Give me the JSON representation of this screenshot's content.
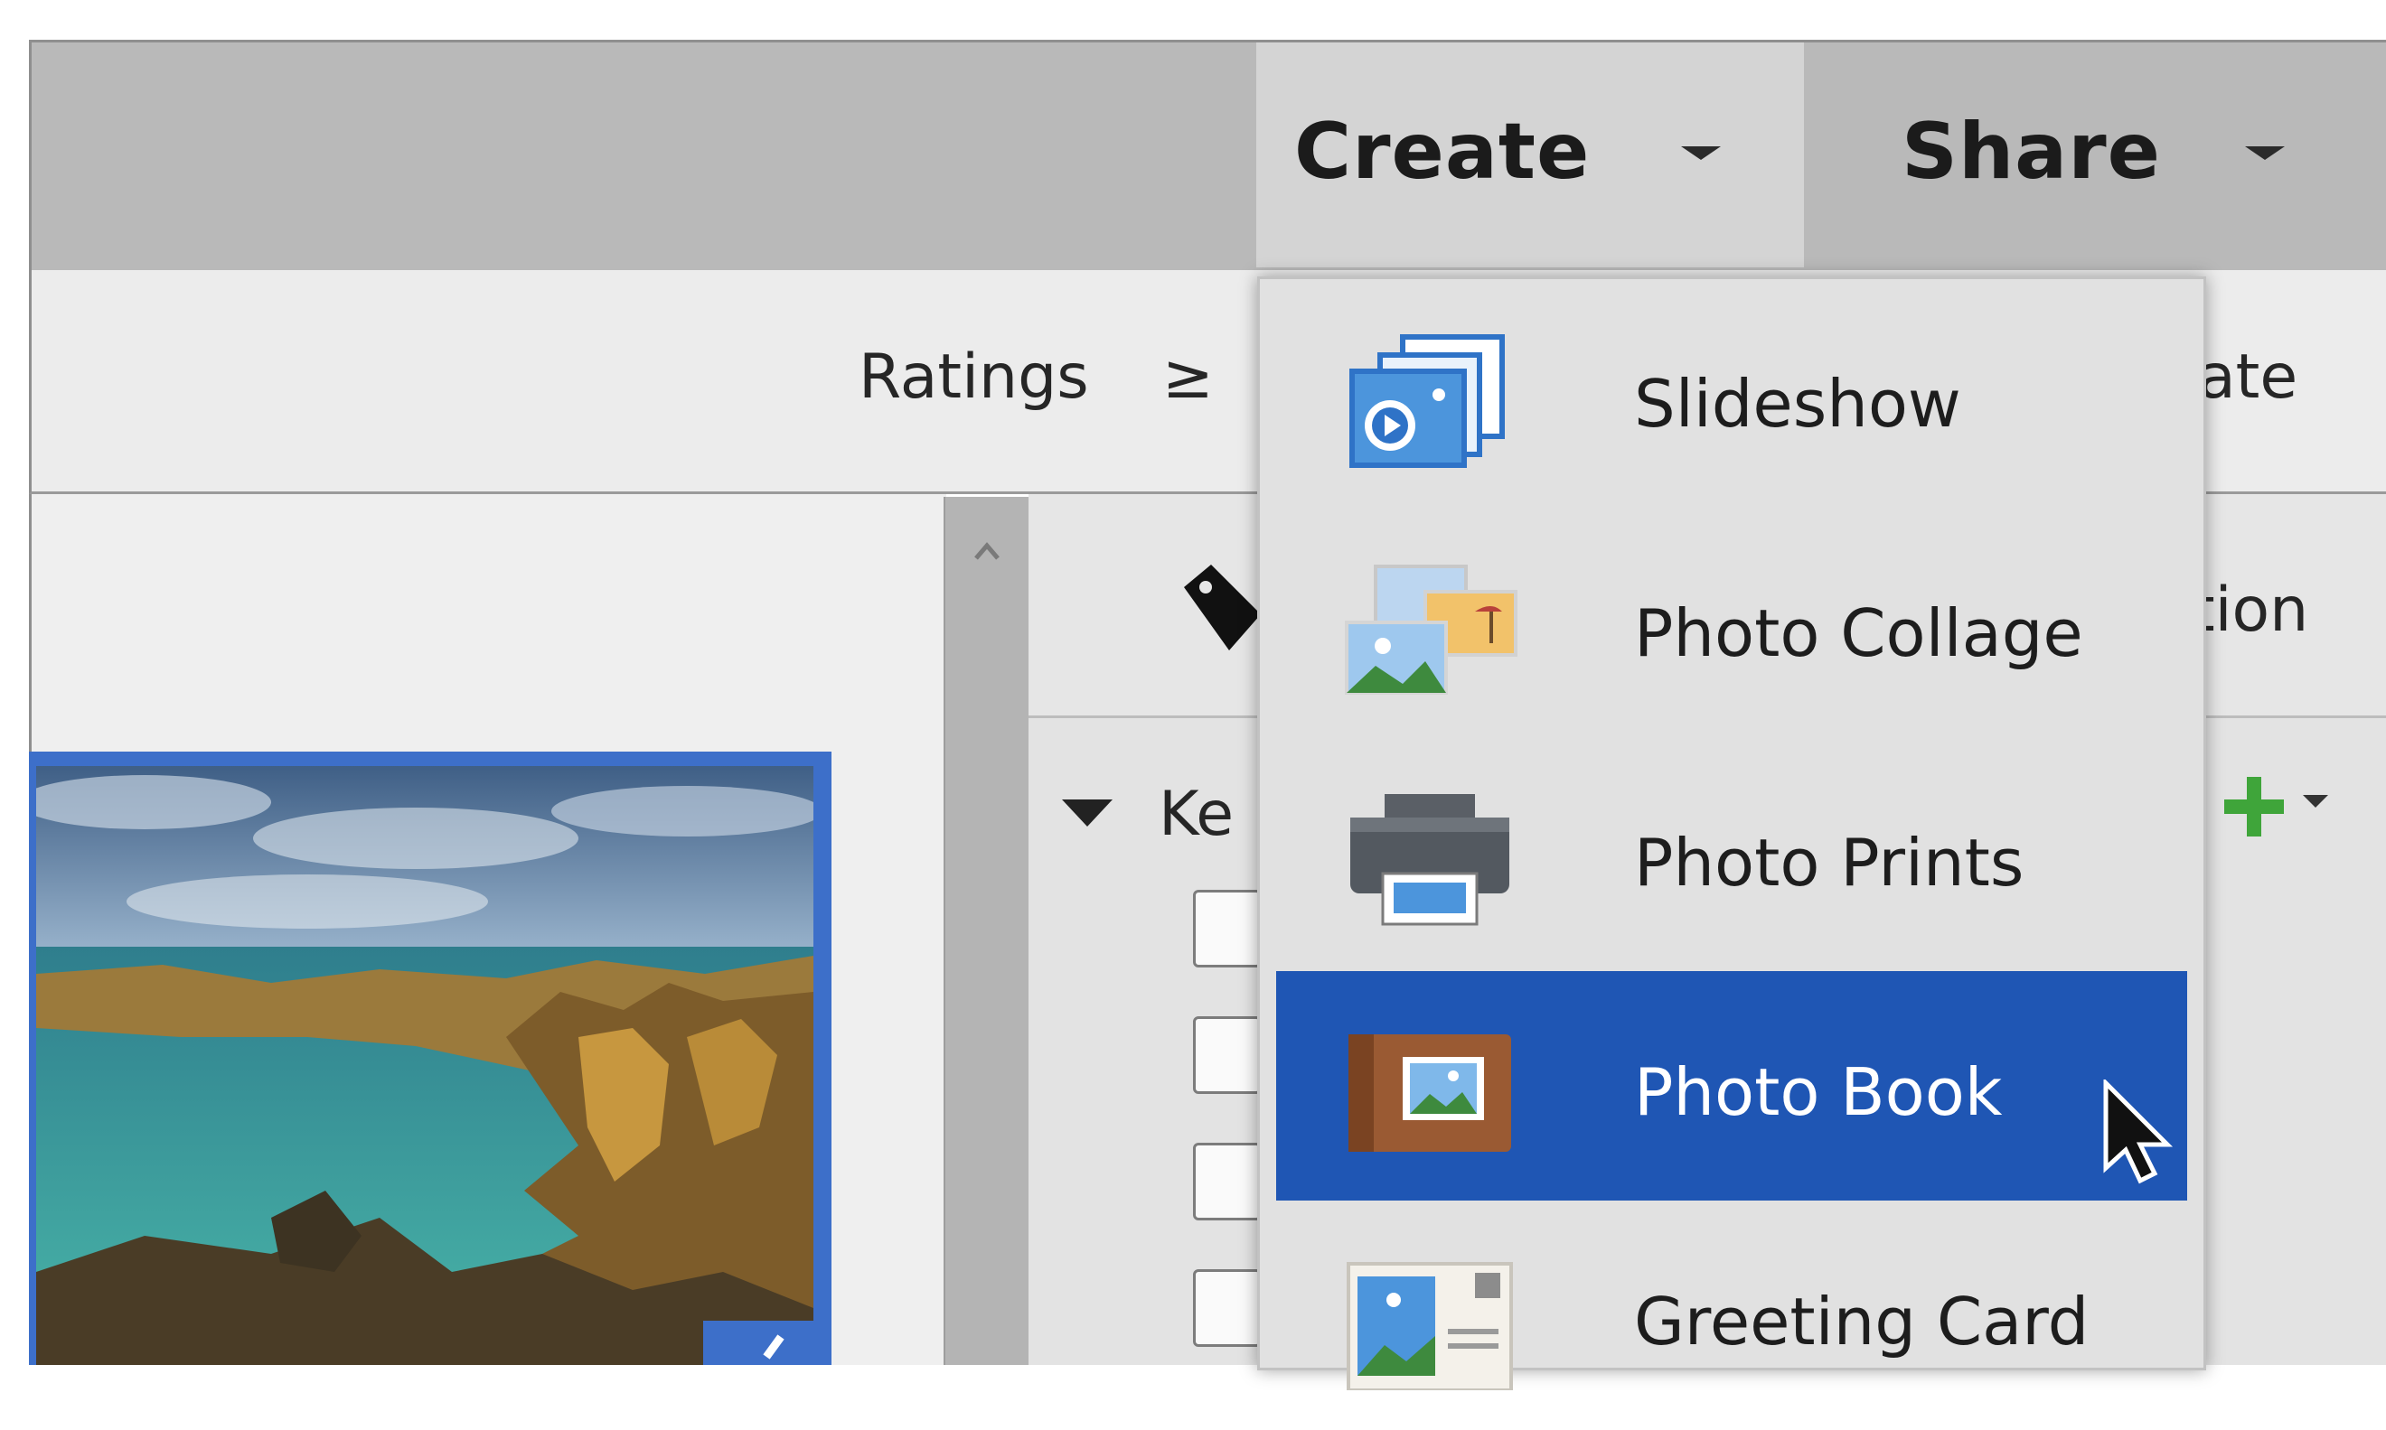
{
  "topbar": {
    "create_label": "Create",
    "share_label": "Share"
  },
  "filterbar": {
    "ratings_label": "Ratings",
    "ratings_operator": "≥",
    "date_partial": "ate"
  },
  "right_panel": {
    "tab_partial": "tion",
    "keywords_partial": "Ke"
  },
  "create_menu": {
    "items": [
      {
        "label": "Slideshow",
        "icon": "slideshow-icon",
        "selected": false
      },
      {
        "label": "Photo Collage",
        "icon": "photo-collage-icon",
        "selected": false
      },
      {
        "label": "Photo Prints",
        "icon": "printer-icon",
        "selected": false
      },
      {
        "label": "Photo Book",
        "icon": "photo-book-icon",
        "selected": true
      },
      {
        "label": "Greeting Card",
        "icon": "greeting-card-icon",
        "selected": false
      }
    ]
  },
  "colors": {
    "selection": "#1f56b4",
    "topbar": "#b9b9b9",
    "add_green": "#3fa53a"
  }
}
